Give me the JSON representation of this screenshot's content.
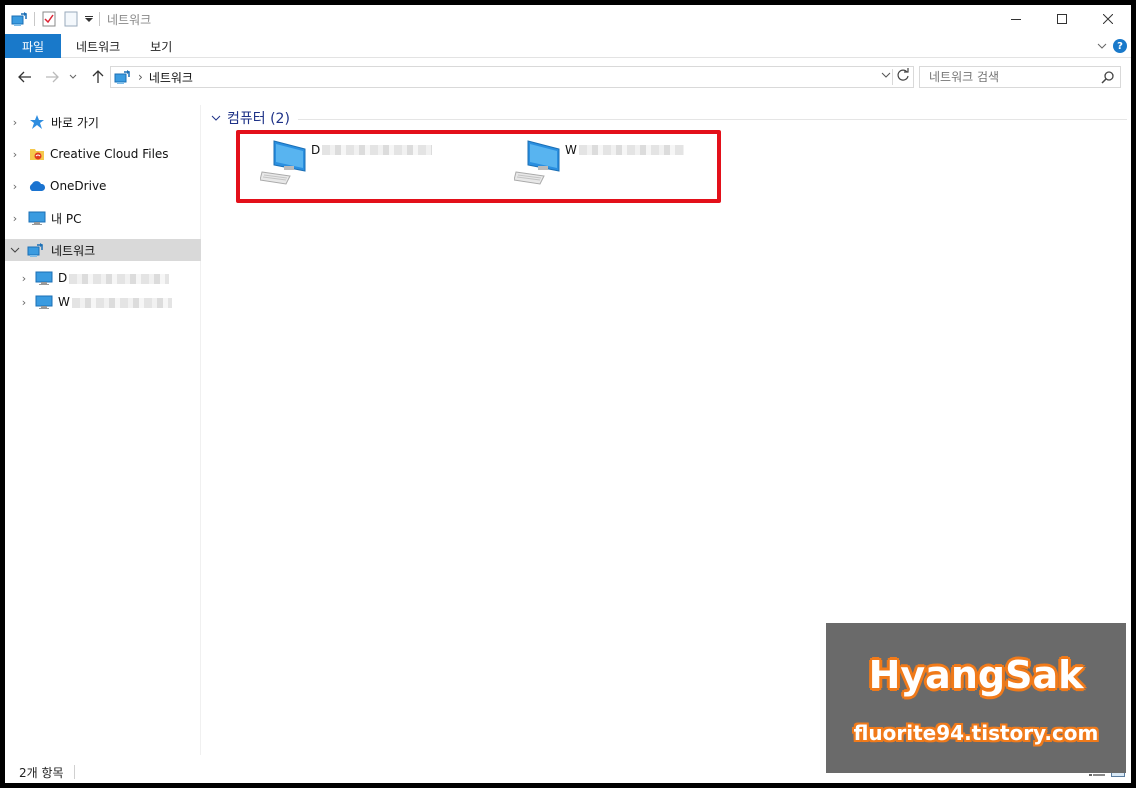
{
  "window": {
    "title": "네트워크",
    "controls": {
      "minimize": "—",
      "maximize": "☐",
      "close": "✕"
    }
  },
  "ribbon": {
    "tabs": [
      {
        "label": "파일"
      },
      {
        "label": "네트워크"
      },
      {
        "label": "보기"
      }
    ],
    "expand_icon": "chevron-down-icon",
    "help_label": "?"
  },
  "address": {
    "path": "네트워크",
    "refresh_icon": "refresh-icon"
  },
  "search": {
    "placeholder": "네트워크 검색"
  },
  "sidebar": {
    "items": [
      {
        "label": "바로 가기",
        "icon": "star-icon"
      },
      {
        "label": "Creative Cloud Files",
        "icon": "creative-cloud-folder-icon"
      },
      {
        "label": "OneDrive",
        "icon": "onedrive-cloud-icon"
      },
      {
        "label": "내 PC",
        "icon": "monitor-icon"
      },
      {
        "label": "네트워크",
        "icon": "network-icon",
        "selected": true
      },
      {
        "label": "D",
        "icon": "computer-icon"
      },
      {
        "label": "W",
        "icon": "computer-icon"
      }
    ]
  },
  "main": {
    "group_title": "컴퓨터 (2)",
    "computers": [
      {
        "name": "D"
      },
      {
        "name": "W"
      }
    ]
  },
  "status": {
    "item_count": "2개 항목"
  },
  "watermark": {
    "title": "HyangSak",
    "url": "fluorite94.tistory.com"
  },
  "colors": {
    "accent": "#1979ca",
    "highlight": "#e3101a",
    "selection": "#d9d9d9",
    "group_title": "#1e3287"
  }
}
